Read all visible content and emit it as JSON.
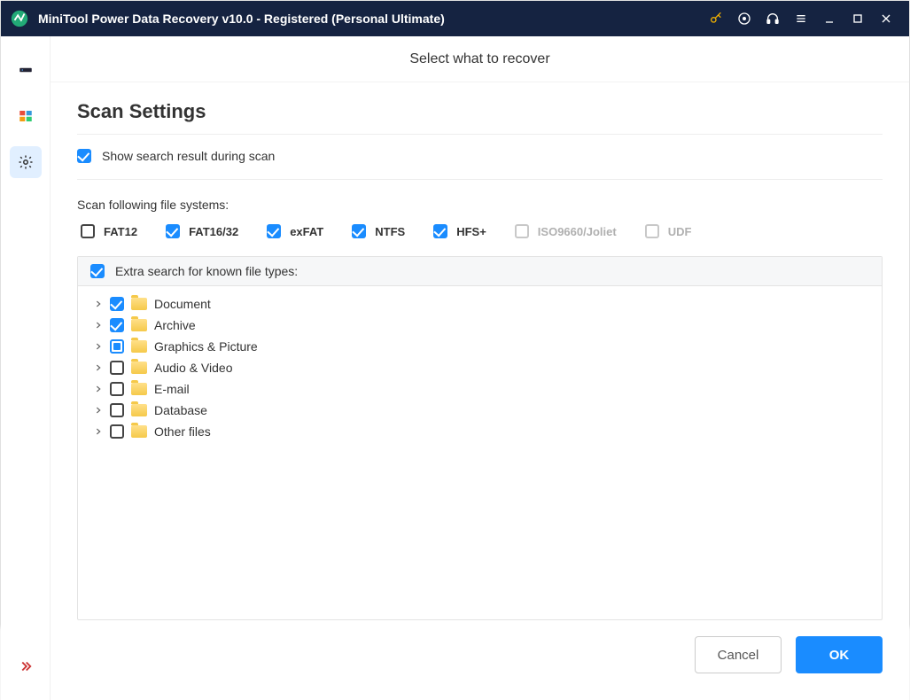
{
  "titlebar": {
    "title": "MiniTool Power Data Recovery v10.0 - Registered (Personal Ultimate)"
  },
  "header": {
    "title": "Select what to recover"
  },
  "page": {
    "title": "Scan Settings",
    "show_result_label": "Show search result during scan",
    "fs_section_label": "Scan following file systems:",
    "extra_search_label": "Extra search for known file types:"
  },
  "filesystems": [
    {
      "id": "fat12",
      "label": "FAT12",
      "state": "empty"
    },
    {
      "id": "fat1632",
      "label": "FAT16/32",
      "state": "checked"
    },
    {
      "id": "exfat",
      "label": "exFAT",
      "state": "checked"
    },
    {
      "id": "ntfs",
      "label": "NTFS",
      "state": "checked"
    },
    {
      "id": "hfs",
      "label": "HFS+",
      "state": "checked"
    },
    {
      "id": "iso",
      "label": "ISO9660/Joliet",
      "state": "disabled"
    },
    {
      "id": "udf",
      "label": "UDF",
      "state": "disabled"
    }
  ],
  "tree": [
    {
      "label": "Document",
      "state": "checked"
    },
    {
      "label": "Archive",
      "state": "checked"
    },
    {
      "label": "Graphics & Picture",
      "state": "partial"
    },
    {
      "label": "Audio & Video",
      "state": "empty"
    },
    {
      "label": "E-mail",
      "state": "empty"
    },
    {
      "label": "Database",
      "state": "empty"
    },
    {
      "label": "Other files",
      "state": "empty"
    }
  ],
  "footer": {
    "cancel": "Cancel",
    "ok": "OK"
  }
}
